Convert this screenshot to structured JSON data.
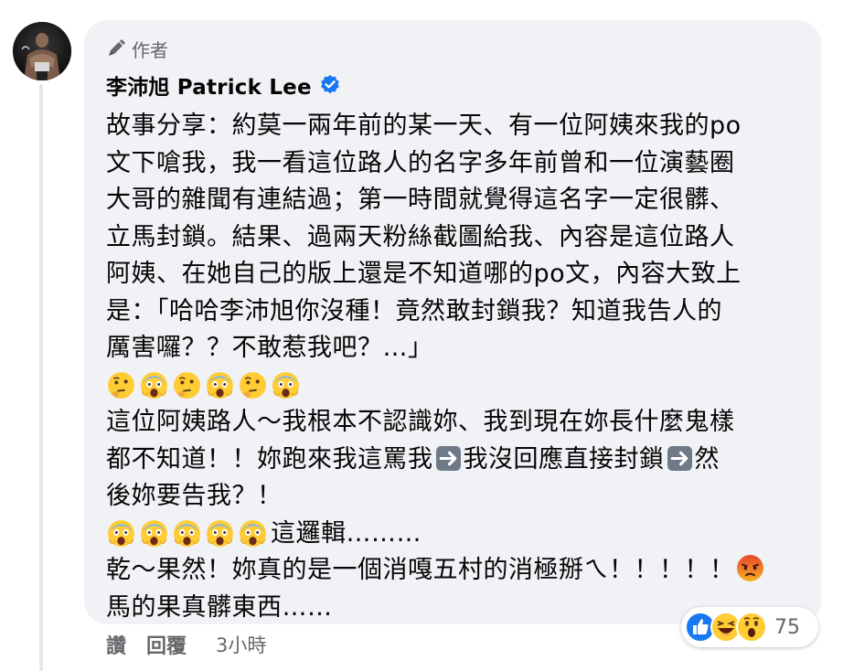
{
  "comment": {
    "author_badge": "作者",
    "author_name": "李沛旭 Patrick Lee",
    "lines": [
      "故事分享：約莫一兩年前的某一天、有一位阿姨來我的po",
      "文下嗆我，我一看這位路人的名字多年前曾和一位演藝圈",
      "大哥的雜聞有連結過；第一時間就覺得這名字一定很髒、",
      "立馬封鎖。結果、過兩天粉絲截圖給我、內容是這位路人",
      "阿姨、在她自己的版上還是不知道哪的po文，內容大致上",
      "是：「哈哈李沛旭你沒種！竟然敢封鎖我？知道我告人的",
      "厲害囉？？不敢惹我吧？…」"
    ],
    "emoji_row_1": [
      "thinking-face",
      "screaming-face",
      "thinking-face",
      "screaming-face",
      "thinking-face",
      "screaming-face"
    ],
    "line_8": "這位阿姨路人～我根本不認識妳、我到現在妳長什麼鬼樣",
    "line_9_a": "都不知道！！妳跑來我這罵我",
    "line_9_b": "我沒回應直接封鎖",
    "line_9_c": "然",
    "line_10": "後妳要告我？！",
    "emoji_row_2": [
      "screaming-face",
      "screaming-face",
      "screaming-face",
      "screaming-face",
      "screaming-face"
    ],
    "emoji_row_2_text": "這邏輯………",
    "line_12": "乾～果然！妳真的是一個消嘎五村的消極掰ㄟ！！！！！",
    "line_12_emoji": "angry-face",
    "line_13": "馬的果真髒東西……"
  },
  "footer": {
    "like_label": "讚",
    "reply_label": "回覆",
    "time": "3小時"
  },
  "reactions": {
    "icons": [
      "like-icon",
      "haha-icon",
      "wow-icon"
    ],
    "count": "75"
  },
  "colors": {
    "bubble": "#f0f2f5",
    "secondary_text": "#65676b",
    "verified_blue": "#1877f2",
    "like_blue": "#1877f2",
    "thread_line": "#e4e6eb"
  }
}
